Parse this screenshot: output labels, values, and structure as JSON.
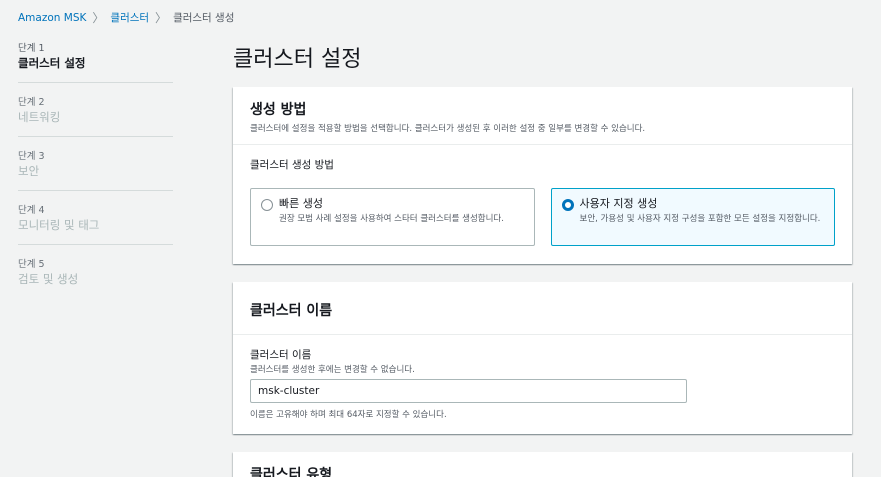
{
  "breadcrumb": {
    "root": "Amazon MSK",
    "parent": "클러스터",
    "current": "클러스터 생성"
  },
  "steps": [
    {
      "num": "단계 1",
      "title": "클러스터 설정"
    },
    {
      "num": "단계 2",
      "title": "네트워킹"
    },
    {
      "num": "단계 3",
      "title": "보안"
    },
    {
      "num": "단계 4",
      "title": "모니터링 및 태그"
    },
    {
      "num": "단계 5",
      "title": "검토 및 생성"
    }
  ],
  "page_title": "클러스터 설정",
  "creation_method": {
    "title": "생성 방법",
    "description": "클러스터에 설정을 적용할 방법을 선택합니다. 클러스터가 생성된 후 이러한 설정 중 일부를 변경할 수 있습니다.",
    "field_label": "클러스터 생성 방법",
    "options": [
      {
        "title": "빠른 생성",
        "description": "권장 모범 사례 설정을 사용하여 스타터 클러스터를 생성합니다."
      },
      {
        "title": "사용자 지정 생성",
        "description": "보안, 가용성 및 사용자 지정 구성을 포함한 모든 설정을 지정합니다."
      }
    ],
    "selected": "사용자 지정 생성"
  },
  "cluster_name": {
    "title": "클러스터 이름",
    "field_label": "클러스터 이름",
    "hint": "클러스터를 생성한 후에는 변경할 수 없습니다.",
    "value": "msk-cluster",
    "constraint": "이름은 고유해야 하며 최대 64자로 지정할 수 있습니다."
  },
  "cluster_type": {
    "title": "클러스터 유형"
  },
  "colors": {
    "link": "#0073bb",
    "selected_border": "#00a1c9",
    "selected_bg": "#f1faff",
    "background": "#f2f3f3"
  }
}
